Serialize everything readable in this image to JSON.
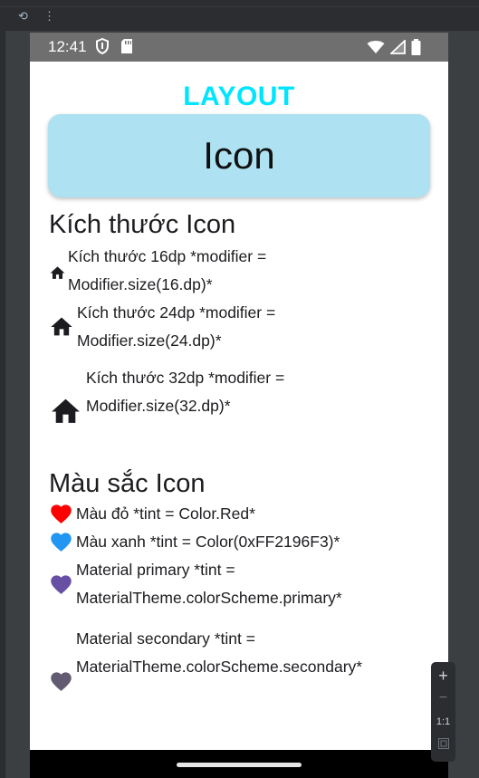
{
  "ide": {
    "refresh_icon": "refresh-icon",
    "more_icon": "more-vert-icon"
  },
  "status_bar": {
    "time": "12:41"
  },
  "screen": {
    "header": "LAYOUT",
    "card_title": "Icon",
    "size_section": {
      "title": "Kích thước Icon",
      "items": [
        {
          "line1": "Kích thước 16dp *modifier =",
          "line2": "Modifier.size(16.dp)*",
          "icon": "home-icon",
          "icon_size_dp": 16
        },
        {
          "line1": "Kích thước 24dp *modifier =",
          "line2": "Modifier.size(24.dp)*",
          "icon": "home-icon",
          "icon_size_dp": 24
        },
        {
          "line1": "Kích thước 32dp *modifier =",
          "line2": "Modifier.size(32.dp)*",
          "icon": "home-icon",
          "icon_size_dp": 32
        }
      ]
    },
    "color_section": {
      "title": "Màu sắc Icon",
      "items": [
        {
          "line1": "Màu đỏ *tint = Color.Red*",
          "icon": "heart-icon",
          "color": "#ff0000"
        },
        {
          "line1": "Màu xanh *tint = Color(0xFF2196F3)*",
          "icon": "heart-icon",
          "color": "#2196f3"
        },
        {
          "line1": "Material primary *tint =",
          "line2": "MaterialTheme.colorScheme.primary*",
          "icon": "heart-icon",
          "color": "#6750a4"
        },
        {
          "line1": "Material secondary *tint =",
          "line2": "MaterialTheme.colorScheme.secondary*",
          "icon": "heart-icon",
          "color": "#625b71"
        }
      ]
    }
  },
  "zoom_controls": {
    "zoom_in": "+",
    "zoom_out": "−",
    "ratio": "1:1"
  }
}
